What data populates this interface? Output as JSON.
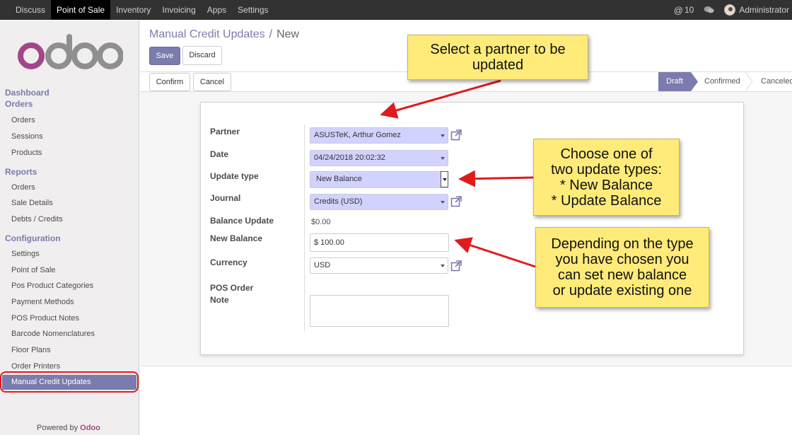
{
  "topbar": {
    "menu": [
      "Discuss",
      "Point of Sale",
      "Inventory",
      "Invoicing",
      "Apps",
      "Settings"
    ],
    "active_index": 1,
    "messages_count": "10",
    "user": "Administrator"
  },
  "sidebar": {
    "logo_text": "odoo",
    "sections": {
      "dashboard": "Dashboard",
      "orders": "Orders",
      "orders_items": [
        "Orders",
        "Sessions",
        "Products"
      ],
      "reports": "Reports",
      "reports_items": [
        "Orders",
        "Sale Details",
        "Debts / Credits"
      ],
      "configuration": "Configuration",
      "config_items": [
        "Settings",
        "Point of Sale",
        "Pos Product Categories",
        "Payment Methods",
        "POS Product Notes",
        "Barcode Nomenclatures",
        "Floor Plans",
        "Order Printers",
        "Manual Credit Updates"
      ]
    },
    "powered_by": "Powered by",
    "powered_brand": "Odoo"
  },
  "breadcrumb": {
    "parent": "Manual Credit Updates",
    "separator": "/",
    "current": "New"
  },
  "buttons": {
    "save": "Save",
    "discard": "Discard",
    "confirm": "Confirm",
    "cancel": "Cancel"
  },
  "status": {
    "stages": [
      "Draft",
      "Confirmed",
      "Canceled"
    ],
    "active": "Draft"
  },
  "form": {
    "partner_label": "Partner",
    "partner_value": "ASUSTeK, Arthur Gomez",
    "date_label": "Date",
    "date_value": "04/24/2018 20:02:32",
    "update_type_label": "Update type",
    "update_type_value": "New Balance",
    "journal_label": "Journal",
    "journal_value": "Credits (USD)",
    "balance_update_label": "Balance Update",
    "balance_update_value": "$0.00",
    "new_balance_label": "New Balance",
    "new_balance_value": "$ 100.00",
    "currency_label": "Currency",
    "currency_value": "USD",
    "pos_note_label_line1": "POS Order",
    "pos_note_label_line2": "Note",
    "pos_note_value": ""
  },
  "callouts": {
    "partner": [
      "Select a partner to be",
      "updated"
    ],
    "update_type": [
      "Choose one of",
      "two update types:",
      "* New Balance",
      "* Update Balance"
    ],
    "balance": [
      "Depending on the type",
      "you have chosen you",
      "can set new balance",
      "or update existing one"
    ]
  },
  "colors": {
    "accent": "#7c7bad",
    "required_field": "#d2d2ff",
    "callout": "#ffeb7a",
    "arrow": "#e01b1b",
    "brand": "#a24689"
  }
}
